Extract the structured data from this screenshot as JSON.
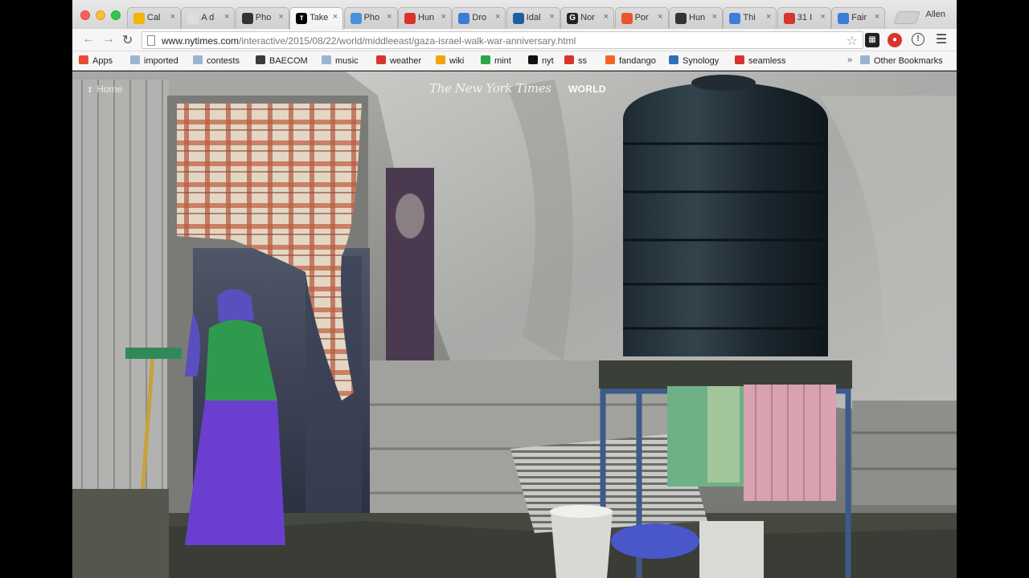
{
  "tabs": [
    {
      "label": "Cal",
      "favicon_color": "#f4b400",
      "glyph": ""
    },
    {
      "label": "A d",
      "favicon_color": "#dddddd",
      "glyph": ""
    },
    {
      "label": "Pho",
      "favicon_color": "#333333",
      "glyph": ""
    },
    {
      "label": "Take",
      "favicon_color": "#000000",
      "glyph": "ᴛ"
    },
    {
      "label": "Pho",
      "favicon_color": "#4a90d9",
      "glyph": ""
    },
    {
      "label": "Hun",
      "favicon_color": "#d9342b",
      "glyph": ""
    },
    {
      "label": "Dro",
      "favicon_color": "#3a7bd5",
      "glyph": ""
    },
    {
      "label": "Idal",
      "favicon_color": "#1f5f9f",
      "glyph": ""
    },
    {
      "label": "Nor",
      "favicon_color": "#222222",
      "glyph": "G"
    },
    {
      "label": "Por",
      "favicon_color": "#e8552f",
      "glyph": ""
    },
    {
      "label": "Hun",
      "favicon_color": "#333333",
      "glyph": ""
    },
    {
      "label": "Thi",
      "favicon_color": "#3b7dd8",
      "glyph": ""
    },
    {
      "label": "31 I",
      "favicon_color": "#d9342b",
      "glyph": ""
    },
    {
      "label": "Fair",
      "favicon_color": "#3b7dd8",
      "glyph": ""
    }
  ],
  "profile_name": "Allen",
  "url": {
    "host": "www.nytimes.com",
    "path": "/interactive/2015/08/22/world/middleeast/gaza-israel-walk-war-anniversary.html"
  },
  "bookmarks": [
    {
      "label": "Apps",
      "icon": "apps-grid-icon",
      "color": "#e94b35"
    },
    {
      "label": "imported",
      "icon": "folder-icon",
      "color": "#9bb5d1"
    },
    {
      "label": "contests",
      "icon": "folder-icon",
      "color": "#9bb5d1"
    },
    {
      "label": "BAECOM",
      "icon": "baecom-icon",
      "color": "#3a3a3a"
    },
    {
      "label": "music",
      "icon": "folder-icon",
      "color": "#9bb5d1"
    },
    {
      "label": "weather",
      "icon": "weather-icon",
      "color": "#d9342b"
    },
    {
      "label": "wiki",
      "icon": "wiki-icon",
      "color": "#f4a300"
    },
    {
      "label": "mint",
      "icon": "mint-icon",
      "color": "#2aa84a"
    },
    {
      "label": "nyt",
      "icon": "nyt-icon",
      "color": "#111111"
    },
    {
      "label": "ss",
      "icon": "ss-icon",
      "color": "#d9342b"
    },
    {
      "label": "fandango",
      "icon": "fandango-icon",
      "color": "#f26522"
    },
    {
      "label": "Synology",
      "icon": "synology-icon",
      "color": "#2f6fb5"
    },
    {
      "label": "seamless",
      "icon": "seamless-icon",
      "color": "#d9342b"
    }
  ],
  "bookmarks_more": "»",
  "other_bookmarks": "Other Bookmarks",
  "page": {
    "home_link": "Home",
    "masthead": "The New York Times",
    "section": "WORLD"
  }
}
